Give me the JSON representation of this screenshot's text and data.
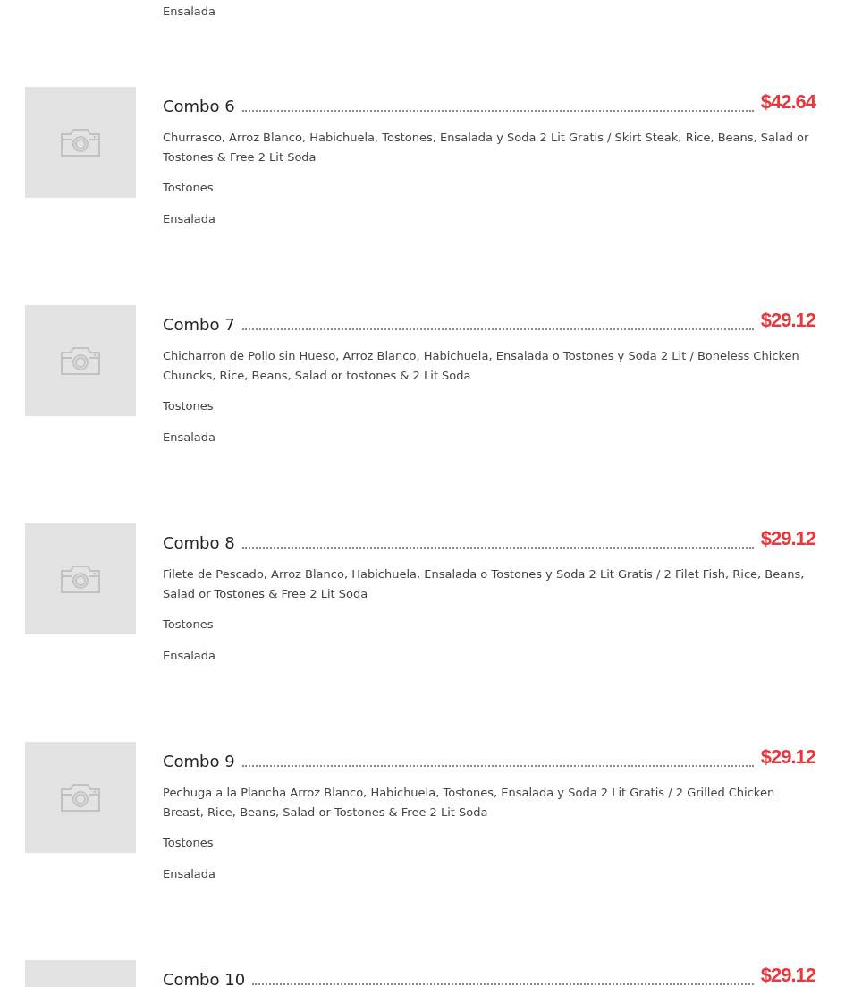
{
  "previous_item": {
    "options": [
      "Ensalada"
    ]
  },
  "items": [
    {
      "title": "Combo 6",
      "price": "$42.64",
      "description": "Churrasco, Arroz Blanco, Habichuela, Tostones, Ensalada y Soda 2 Lit Gratis / Skirt Steak, Rice, Beans, Salad or Tostones & Free 2 Lit Soda",
      "options": [
        "Tostones",
        "Ensalada"
      ]
    },
    {
      "title": "Combo 7",
      "price": "$29.12",
      "description": "Chicharron de Pollo sin Hueso, Arroz Blanco, Habichuela, Ensalada o Tostones y Soda 2 Lit / Boneless Chicken Chuncks, Rice, Beans, Salad or tostones & 2 Lit Soda",
      "options": [
        "Tostones",
        "Ensalada"
      ]
    },
    {
      "title": "Combo 8",
      "price": "$29.12",
      "description": "Filete de Pescado, Arroz Blanco, Habichuela, Ensalada o Tostones y Soda 2 Lit Gratis / 2 Filet Fish, Rice, Beans, Salad or Tostones & Free 2 Lit Soda",
      "options": [
        "Tostones",
        "Ensalada"
      ]
    },
    {
      "title": "Combo 9",
      "price": "$29.12",
      "description": "Pechuga a la Plancha Arroz Blanco, Habichuela, Tostones, Ensalada y Soda 2 Lit Gratis / 2 Grilled Chicken Breast, Rice, Beans, Salad or Tostones & Free 2 Lit Soda",
      "options": [
        "Tostones",
        "Ensalada"
      ]
    },
    {
      "title": "Combo 10",
      "price": "$29.12"
    }
  ]
}
